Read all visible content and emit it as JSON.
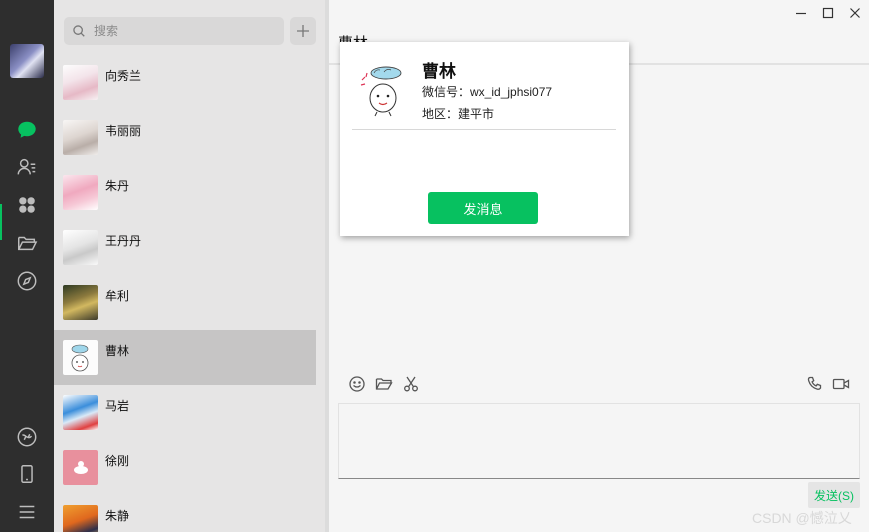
{
  "search": {
    "placeholder": "搜索"
  },
  "contacts": [
    {
      "name": "向秀兰",
      "avatar_color": "#f3eef0",
      "active": false
    },
    {
      "name": "韦丽丽",
      "avatar_color": "#ece8e6",
      "active": false
    },
    {
      "name": "朱丹",
      "avatar_color": "#f5dbe3",
      "active": false
    },
    {
      "name": "王丹丹",
      "avatar_color": "#efefef",
      "active": false
    },
    {
      "name": "牟利",
      "avatar_color": "#7a6a3a",
      "active": false
    },
    {
      "name": "曹林",
      "avatar_color": "#fbfbfb",
      "active": true
    },
    {
      "name": "马岩",
      "avatar_color": "#4a90d9",
      "active": false
    },
    {
      "name": "徐刚",
      "avatar_color": "#e88f9c",
      "active": false
    },
    {
      "name": "朱静",
      "avatar_color": "#e07a2a",
      "active": false
    }
  ],
  "chat": {
    "title": "曹林",
    "send_label": "发送(S)"
  },
  "profile": {
    "name": "曹林",
    "wechat_id_label": "微信号：",
    "wechat_id": "wx_id_jphsi077",
    "region_label": "地区：",
    "region": "建平市",
    "message_button": "发消息"
  },
  "watermark": "CSDN @憾泣乂",
  "colors": {
    "accent": "#07c160",
    "sidebar": "#2e2e2e",
    "list_bg": "#e6e5e5",
    "active_row": "#c6c5c5"
  },
  "icons": {
    "sidebar": [
      "chat-icon",
      "contacts-icon",
      "favorites-icon",
      "folder-icon",
      "moments-icon",
      "mini-program-icon",
      "phone-icon",
      "menu-icon"
    ],
    "toolbar": [
      "emoji-icon",
      "folder-icon",
      "scissors-icon",
      "voice-call-icon",
      "video-call-icon"
    ],
    "window": [
      "minimize-icon",
      "maximize-icon",
      "close-icon"
    ]
  }
}
